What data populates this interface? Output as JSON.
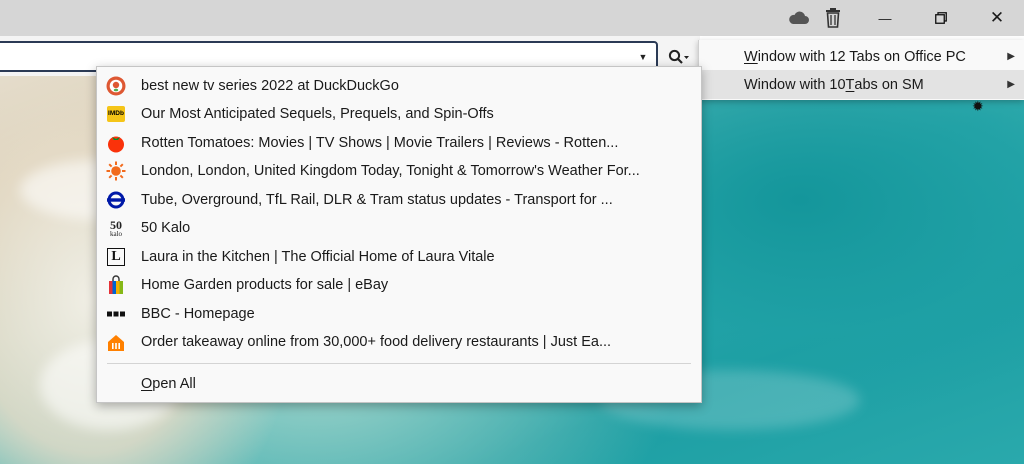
{
  "titlebar": {
    "cloud_icon": "cloud-icon",
    "trash_icon": "trash-icon",
    "minimize_glyph": "—",
    "restore_glyph": "❐",
    "close_glyph": "✕"
  },
  "urlbar": {
    "value": "",
    "dropdown_glyph": "▼"
  },
  "submenu": {
    "items": [
      {
        "prefix": "",
        "accel": "W",
        "rest": "indow with 12 Tabs on Office PC"
      },
      {
        "prefix": "Window with 10 ",
        "accel": "T",
        "rest": "abs on SM"
      }
    ],
    "arrow": "▶"
  },
  "popup": {
    "items": [
      {
        "label": "best new tv series 2022 at DuckDuckGo",
        "icon": "duckduckgo-icon"
      },
      {
        "label": "Our Most Anticipated Sequels, Prequels, and Spin-Offs",
        "icon": "imdb-icon"
      },
      {
        "label": "Rotten Tomatoes: Movies | TV Shows | Movie Trailers | Reviews - Rotten...",
        "icon": "tomato-icon"
      },
      {
        "label": "London, London, United Kingdom Today, Tonight & Tomorrow's Weather For...",
        "icon": "sun-icon"
      },
      {
        "label": "Tube, Overground, TfL Rail, DLR & Tram status updates - Transport for ...",
        "icon": "tfl-roundel-icon"
      },
      {
        "label": "50 Kalo",
        "icon": "50-kalo-icon"
      },
      {
        "label": "Laura in the Kitchen | The Official Home of Laura Vitale",
        "icon": "laura-l-icon"
      },
      {
        "label": "Home Garden products for sale | eBay",
        "icon": "ebay-bag-icon"
      },
      {
        "label": "BBC - Homepage",
        "icon": "bbc-icon"
      },
      {
        "label": "Order takeaway online from 30,000+ food delivery restaurants | Just Ea...",
        "icon": "just-eat-icon"
      }
    ],
    "open_all": {
      "accel": "O",
      "rest": "pen All"
    },
    "icon_text": {
      "imdb": "IMDb",
      "kalo_top": "50",
      "kalo_bottom": "kalo",
      "laura": "L"
    }
  },
  "colors": {
    "titlebar": "#d6d6d6",
    "menu_bg": "#f9f9f9",
    "menu_highlight": "#e3e3e3",
    "urlbar_border": "#2b3a55"
  }
}
